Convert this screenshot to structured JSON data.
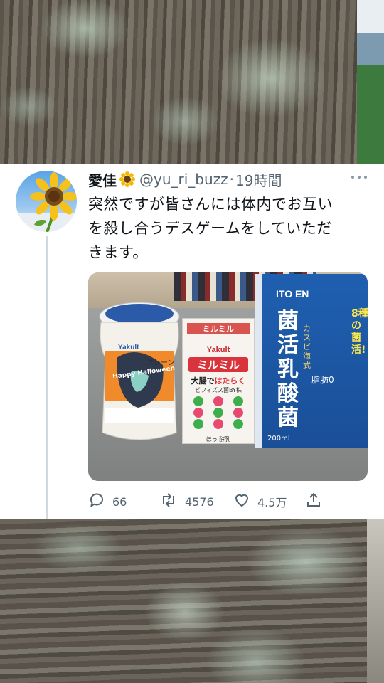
{
  "tweet": {
    "display_name": "愛佳",
    "name_emoji": "sunflower",
    "handle": "@yu_ri_buzz",
    "separator": "·",
    "time": "19時間",
    "text_lines": [
      "突然ですが皆さんには体内でお互い",
      "を殺し合うデスゲームをしていただ",
      "きます。"
    ],
    "media": {
      "bottle_brand": "Yakult",
      "bottle_label": "Happy Halloween",
      "bottle_flavor": "プレーン",
      "milmil_top": "ミルミル",
      "milmil_brand": "Yakult",
      "milmil_name": "ミルミル",
      "milmil_sub1": "大腸で",
      "milmil_sub2": "はたらく",
      "milmil_sub3": "ビフィズス菌BY株",
      "milmil_bottom": "ほっ 酵乳",
      "itoen_brand": "ITO EN",
      "itoen_name": "菌活乳酸菌",
      "itoen_tag": "8種の菌活!",
      "itoen_sub": "カスピ海式",
      "itoen_fat": "脂肪0",
      "itoen_volume": "200ml"
    },
    "actions": {
      "reply_count": "66",
      "retweet_count": "4576",
      "like_count": "4.5万"
    }
  },
  "icons": [
    "reply-icon",
    "retweet-icon",
    "like-icon",
    "share-icon",
    "more-icon"
  ],
  "colors": {
    "text_primary": "#0f1419",
    "text_secondary": "#536471",
    "thread_line": "#cfd9de"
  }
}
